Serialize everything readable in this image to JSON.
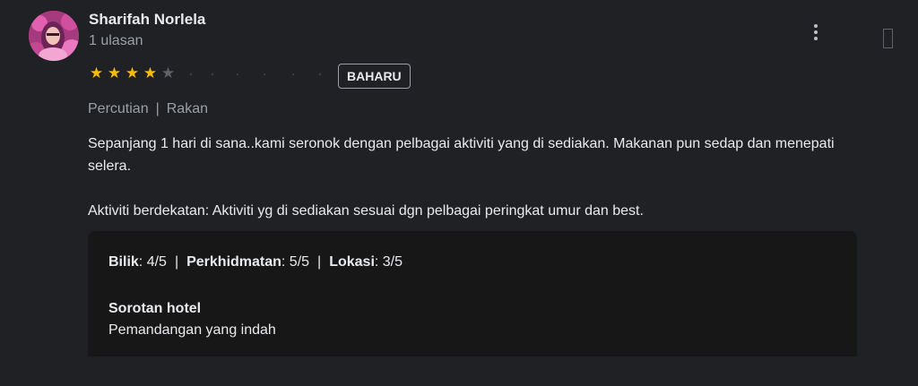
{
  "author": {
    "name": "Sharifah Norlela",
    "review_count": "1 ulasan"
  },
  "rating": {
    "value": 4,
    "max": 5,
    "star_color": "#fbbc04"
  },
  "badge": "BAHARU",
  "trip": {
    "type": "Percutian",
    "separator": "|",
    "companion": "Rakan"
  },
  "review": {
    "paragraph1": "Sepanjang 1 hari di sana..kami seronok dengan pelbagai aktiviti yang di sediakan. Makanan pun sedap dan menepati selera.",
    "paragraph2": "Aktiviti berdekatan: Aktiviti yg di sediakan sesuai dgn pelbagai peringkat umur dan best."
  },
  "sub_ratings": {
    "room_label": "Bilik",
    "room_value": ": 4/5",
    "service_label": "Perkhidmatan",
    "service_value": ": 5/5",
    "location_label": "Lokasi",
    "location_value": ": 3/5",
    "separator": "|"
  },
  "highlights": {
    "title": "Sorotan hotel",
    "text": "Pemandangan yang indah"
  },
  "icons": {
    "more": "more-vert-icon",
    "avatar": "profile-photo"
  }
}
